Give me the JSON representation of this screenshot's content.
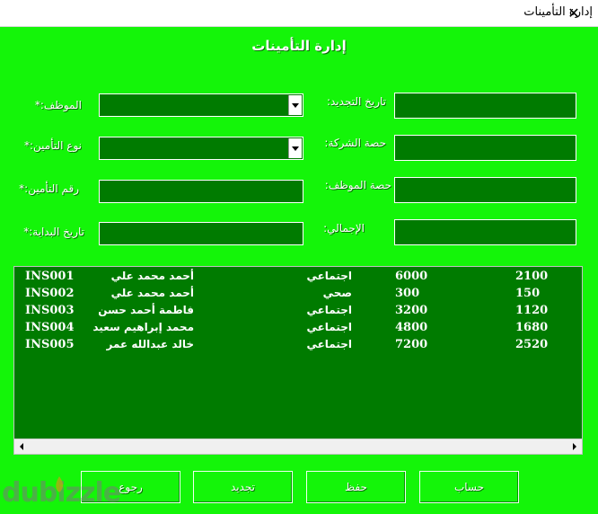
{
  "window": {
    "title": "إدارة التأمينات",
    "close_glyph": "✕"
  },
  "form": {
    "title": "إدارة التأمينات"
  },
  "labels": {
    "employee": "الموظف:*",
    "insurance_type": "نوع التأمين:*",
    "insurance_number": "رقم التأمين:*",
    "start_date": "تاريخ البداية:*",
    "renewal_date": "تاريخ التجديد:",
    "company_share": "حصة الشركة:",
    "employee_share": "حصة الموظف:",
    "total": "الإجمالي:"
  },
  "inputs": {
    "employee": "",
    "insurance_type": "",
    "insurance_number": "",
    "start_date": "",
    "renewal_date": "",
    "company_share": "",
    "employee_share": "",
    "total": ""
  },
  "records": [
    {
      "id": "INS001",
      "name": "أحمد محمد علي",
      "type": "اجتماعي",
      "amount": "6000",
      "share": "2100"
    },
    {
      "id": "INS002",
      "name": "أحمد محمد علي",
      "type": "صحي",
      "amount": "300",
      "share": "150"
    },
    {
      "id": "INS003",
      "name": "فاطمة أحمد حسن",
      "type": "اجتماعي",
      "amount": "3200",
      "share": "1120"
    },
    {
      "id": "INS004",
      "name": "محمد إبراهيم سعيد",
      "type": "اجتماعي",
      "amount": "4800",
      "share": "1680"
    },
    {
      "id": "INS005",
      "name": "خالد عبدالله عمر",
      "type": "اجتماعي",
      "amount": "7200",
      "share": "2520"
    }
  ],
  "buttons": {
    "back": "رجوع",
    "renew": "تجديد",
    "save": "حفظ",
    "calculate": "حساب"
  },
  "watermark": {
    "text": "dubizzle"
  },
  "colors": {
    "background": "#14f509",
    "field": "#007b00",
    "text": "#ffffff"
  },
  "icons": {
    "dropdown": "chevron-down-icon",
    "scroll_left": "arrow-left-icon",
    "scroll_right": "arrow-right-icon"
  }
}
